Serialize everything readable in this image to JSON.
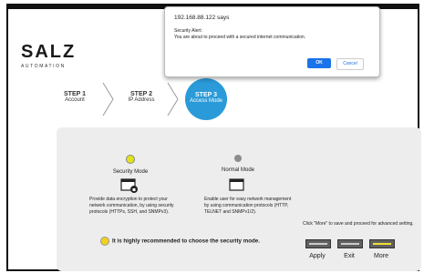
{
  "brand": {
    "name": "SALZ",
    "tagline": "AUTOMATION"
  },
  "steps": [
    {
      "title": "STEP 1",
      "label": "Account"
    },
    {
      "title": "STEP 2",
      "label": "IP Address"
    },
    {
      "title": "STEP 3",
      "label": "Access Mode"
    }
  ],
  "modes": [
    {
      "label": "Security Mode",
      "selected": true,
      "icon": "secure-window-icon",
      "dot_color": "#e2e21a",
      "description": "Provide data encryption to protect your network communication, by using security protocols (HTTPs, SSH, and SNMPv3)."
    },
    {
      "label": "Normal Mode",
      "selected": false,
      "icon": "window-icon",
      "dot_color": "#8c8c8c",
      "description": "Enable user for easy network management by using communication protocols (HTTP, TELNET and SNMPv1/2)."
    }
  ],
  "recommendation": "It is highly recommended to choose the security mode.",
  "more_note": "Click \"More\" to save and proceed for advanced setting.",
  "buttons": [
    {
      "label": "Apply",
      "color": "#606060"
    },
    {
      "label": "Exit",
      "color": "#606060"
    },
    {
      "label": "More",
      "color": "#606060"
    }
  ],
  "alert": {
    "origin": "192.168.88.122 says",
    "title": "Security Alert:",
    "message": "You are about to proceed with a secured internet communication.",
    "ok_label": "OK",
    "cancel_label": "Cancel"
  }
}
